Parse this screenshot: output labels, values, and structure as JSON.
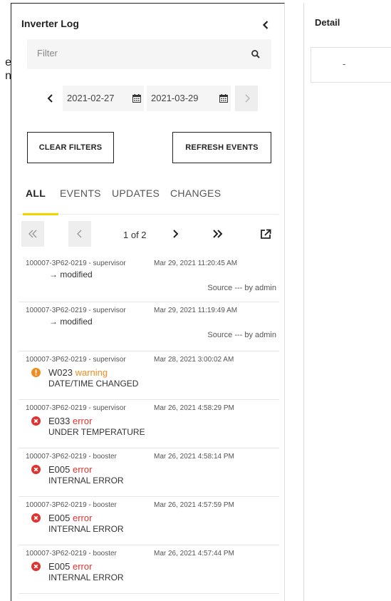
{
  "background": {
    "line1": "e",
    "line2": "n"
  },
  "panel": {
    "title": "Inverter Log",
    "filter": {
      "placeholder": "Filter"
    },
    "date_from": "2021-02-27",
    "date_to": "2021-03-29",
    "buttons": {
      "clear": "CLEAR FILTERS",
      "refresh": "REFRESH EVENTS"
    },
    "tabs": [
      {
        "label": "ALL",
        "active": true
      },
      {
        "label": "EVENTS",
        "active": false
      },
      {
        "label": "UPDATES",
        "active": false
      },
      {
        "label": "CHANGES",
        "active": false
      }
    ],
    "pager": {
      "page_text": "1 of 2"
    },
    "entries": [
      {
        "device": "100007-3P62-0219 - supervisor",
        "time": "Mar 29, 2021 11:20:45 AM",
        "change": "→ modified",
        "source": "Source --- by admin"
      },
      {
        "device": "100007-3P62-0219 - supervisor",
        "time": "Mar 29, 2021 11:19:49 AM",
        "change": "→ modified",
        "source": "Source --- by admin"
      },
      {
        "device": "100007-3P62-0219 - supervisor",
        "time": "Mar 28, 2021 3:00:02 AM",
        "code": "W023",
        "severity": "warning",
        "description": "DATE/TIME CHANGED"
      },
      {
        "device": "100007-3P62-0219 - supervisor",
        "time": "Mar 26, 2021 4:58:29 PM",
        "code": "E033",
        "severity": "error",
        "description": "UNDER TEMPERATURE"
      },
      {
        "device": "100007-3P62-0219 - booster",
        "time": "Mar 26, 2021 4:58:14 PM",
        "code": "E005",
        "severity": "error",
        "description": "INTERNAL ERROR"
      },
      {
        "device": "100007-3P62-0219 - booster",
        "time": "Mar 26, 2021 4:57:59 PM",
        "code": "E005",
        "severity": "error",
        "description": "INTERNAL ERROR"
      },
      {
        "device": "100007-3P62-0219 - booster",
        "time": "Mar 26, 2021 4:57:44 PM",
        "code": "E005",
        "severity": "error",
        "description": "INTERNAL ERROR"
      }
    ]
  },
  "detail": {
    "title": "Detail",
    "value": "-"
  },
  "icons": {
    "collapse": "chevron-left-icon",
    "search": "search-icon",
    "calendar": "calendar-icon",
    "warning": "warning-circle-icon",
    "error": "error-circle-icon",
    "export": "export-icon"
  },
  "colors": {
    "accent": "#f2d500",
    "warning": "#ef8c1f",
    "error": "#e0322f"
  }
}
